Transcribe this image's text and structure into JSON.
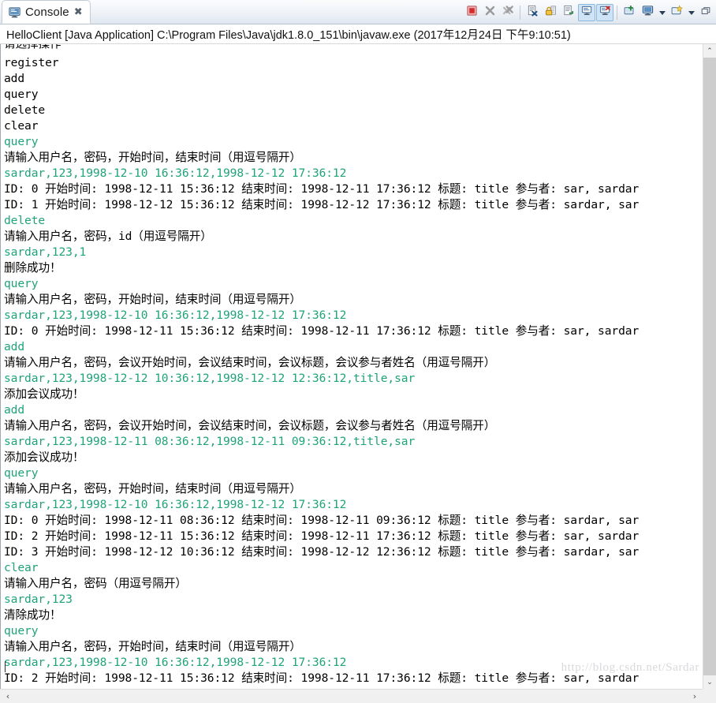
{
  "window": {
    "tab": {
      "label": "Console",
      "icon": "console-icon",
      "close": "✖"
    },
    "toolbar": [
      {
        "name": "terminate-button",
        "icon": "stop-square-icon",
        "toggled": false
      },
      {
        "name": "remove-launch-button",
        "icon": "gray-x-icon",
        "toggled": false
      },
      {
        "name": "remove-all-terminated-button",
        "icon": "gray-double-x-icon",
        "toggled": false
      },
      {
        "name": "clear-console-button",
        "icon": "clear-console-icon",
        "toggled": false
      },
      {
        "name": "scroll-lock-button",
        "icon": "padlock-icon",
        "toggled": false
      },
      {
        "name": "word-wrap-button",
        "icon": "word-wrap-icon",
        "toggled": false
      },
      {
        "name": "show-console-on-output-button",
        "icon": "console-out-icon",
        "toggled": true
      },
      {
        "name": "show-console-on-error-button",
        "icon": "console-err-icon",
        "toggled": true
      },
      {
        "name": "pin-console-button",
        "icon": "pin-console-icon",
        "toggled": false
      },
      {
        "name": "display-selected-console-button",
        "icon": "display-console-icon",
        "toggled": false
      },
      {
        "name": "display-selected-console-dropdown",
        "icon": "chevron-down-icon",
        "toggled": false
      },
      {
        "name": "open-console-button",
        "icon": "new-console-icon",
        "toggled": false
      },
      {
        "name": "open-console-dropdown",
        "icon": "chevron-down-icon",
        "toggled": false
      },
      {
        "name": "view-menu-button",
        "icon": "minimize-restore-icon",
        "toggled": false
      }
    ]
  },
  "launch": {
    "line": "HelloClient [Java Application] C:\\Program Files\\Java\\jdk1.8.0_151\\bin\\javaw.exe (2017年12月24日 下午9:10:51)"
  },
  "console": {
    "watermark": "http://blog.csdn.net/Sardar",
    "lines": [
      {
        "text": "请选择操作",
        "stream": "out",
        "clipped": true
      },
      {
        "text": "register",
        "stream": "out"
      },
      {
        "text": "add",
        "stream": "out"
      },
      {
        "text": "query",
        "stream": "out"
      },
      {
        "text": "delete",
        "stream": "out"
      },
      {
        "text": "clear",
        "stream": "out"
      },
      {
        "text": "query",
        "stream": "in"
      },
      {
        "text": "请输入用户名，密码，开始时间，结束时间（用逗号隔开）",
        "stream": "out"
      },
      {
        "text": "sardar,123,1998-12-10 16:36:12,1998-12-12 17:36:12",
        "stream": "in"
      },
      {
        "text": "ID: 0 开始时间: 1998-12-11 15:36:12 结束时间: 1998-12-11 17:36:12 标题: title 参与者: sar, sardar",
        "stream": "out"
      },
      {
        "text": "ID: 1 开始时间: 1998-12-12 15:36:12 结束时间: 1998-12-12 17:36:12 标题: title 参与者: sardar, sar",
        "stream": "out"
      },
      {
        "text": "delete",
        "stream": "in"
      },
      {
        "text": "请输入用户名，密码，id（用逗号隔开）",
        "stream": "out"
      },
      {
        "text": "sardar,123,1",
        "stream": "in"
      },
      {
        "text": "删除成功！",
        "stream": "out"
      },
      {
        "text": "query",
        "stream": "in"
      },
      {
        "text": "请输入用户名，密码，开始时间，结束时间（用逗号隔开）",
        "stream": "out"
      },
      {
        "text": "sardar,123,1998-12-10 16:36:12,1998-12-12 17:36:12",
        "stream": "in"
      },
      {
        "text": "ID: 0 开始时间: 1998-12-11 15:36:12 结束时间: 1998-12-11 17:36:12 标题: title 参与者: sar, sardar",
        "stream": "out"
      },
      {
        "text": "add",
        "stream": "in"
      },
      {
        "text": "请输入用户名，密码，会议开始时间，会议结束时间，会议标题，会议参与者姓名（用逗号隔开）",
        "stream": "out"
      },
      {
        "text": "sardar,123,1998-12-12 10:36:12,1998-12-12 12:36:12,title,sar",
        "stream": "in"
      },
      {
        "text": "添加会议成功！",
        "stream": "out"
      },
      {
        "text": "add",
        "stream": "in"
      },
      {
        "text": "请输入用户名，密码，会议开始时间，会议结束时间，会议标题，会议参与者姓名（用逗号隔开）",
        "stream": "out"
      },
      {
        "text": "sardar,123,1998-12-11 08:36:12,1998-12-11 09:36:12,title,sar",
        "stream": "in"
      },
      {
        "text": "添加会议成功！",
        "stream": "out"
      },
      {
        "text": "query",
        "stream": "in"
      },
      {
        "text": "请输入用户名，密码，开始时间，结束时间（用逗号隔开）",
        "stream": "out"
      },
      {
        "text": "sardar,123,1998-12-10 16:36:12,1998-12-12 17:36:12",
        "stream": "in"
      },
      {
        "text": "ID: 0 开始时间: 1998-12-11 08:36:12 结束时间: 1998-12-11 09:36:12 标题: title 参与者: sardar, sar",
        "stream": "out"
      },
      {
        "text": "ID: 2 开始时间: 1998-12-11 15:36:12 结束时间: 1998-12-11 17:36:12 标题: title 参与者: sar, sardar",
        "stream": "out"
      },
      {
        "text": "ID: 3 开始时间: 1998-12-12 10:36:12 结束时间: 1998-12-12 12:36:12 标题: title 参与者: sardar, sar",
        "stream": "out"
      },
      {
        "text": "clear",
        "stream": "in"
      },
      {
        "text": "请输入用户名，密码（用逗号隔开）",
        "stream": "out"
      },
      {
        "text": "sardar,123",
        "stream": "in"
      },
      {
        "text": "清除成功！",
        "stream": "out"
      },
      {
        "text": "query",
        "stream": "in"
      },
      {
        "text": "请输入用户名，密码，开始时间，结束时间（用逗号隔开）",
        "stream": "out"
      },
      {
        "text": "sardar,123,1998-12-10 16:36:12,1998-12-12 17:36:12",
        "stream": "in"
      },
      {
        "text": "ID: 2 开始时间: 1998-12-11 15:36:12 结束时间: 1998-12-11 17:36:12 标题: title 参与者: sar, sardar",
        "stream": "out"
      }
    ]
  },
  "scrollbars": {
    "vertical": {
      "up": "⌃",
      "down": "⌄"
    },
    "horizontal": {
      "left": "‹",
      "right": "›"
    }
  },
  "colors": {
    "stdout": "#000000",
    "stdin": "#20a37a",
    "tab_active_bg": "#ffffff",
    "toolbar_toggled": "#cfe3f7",
    "watermark": "#d9d9dd"
  }
}
